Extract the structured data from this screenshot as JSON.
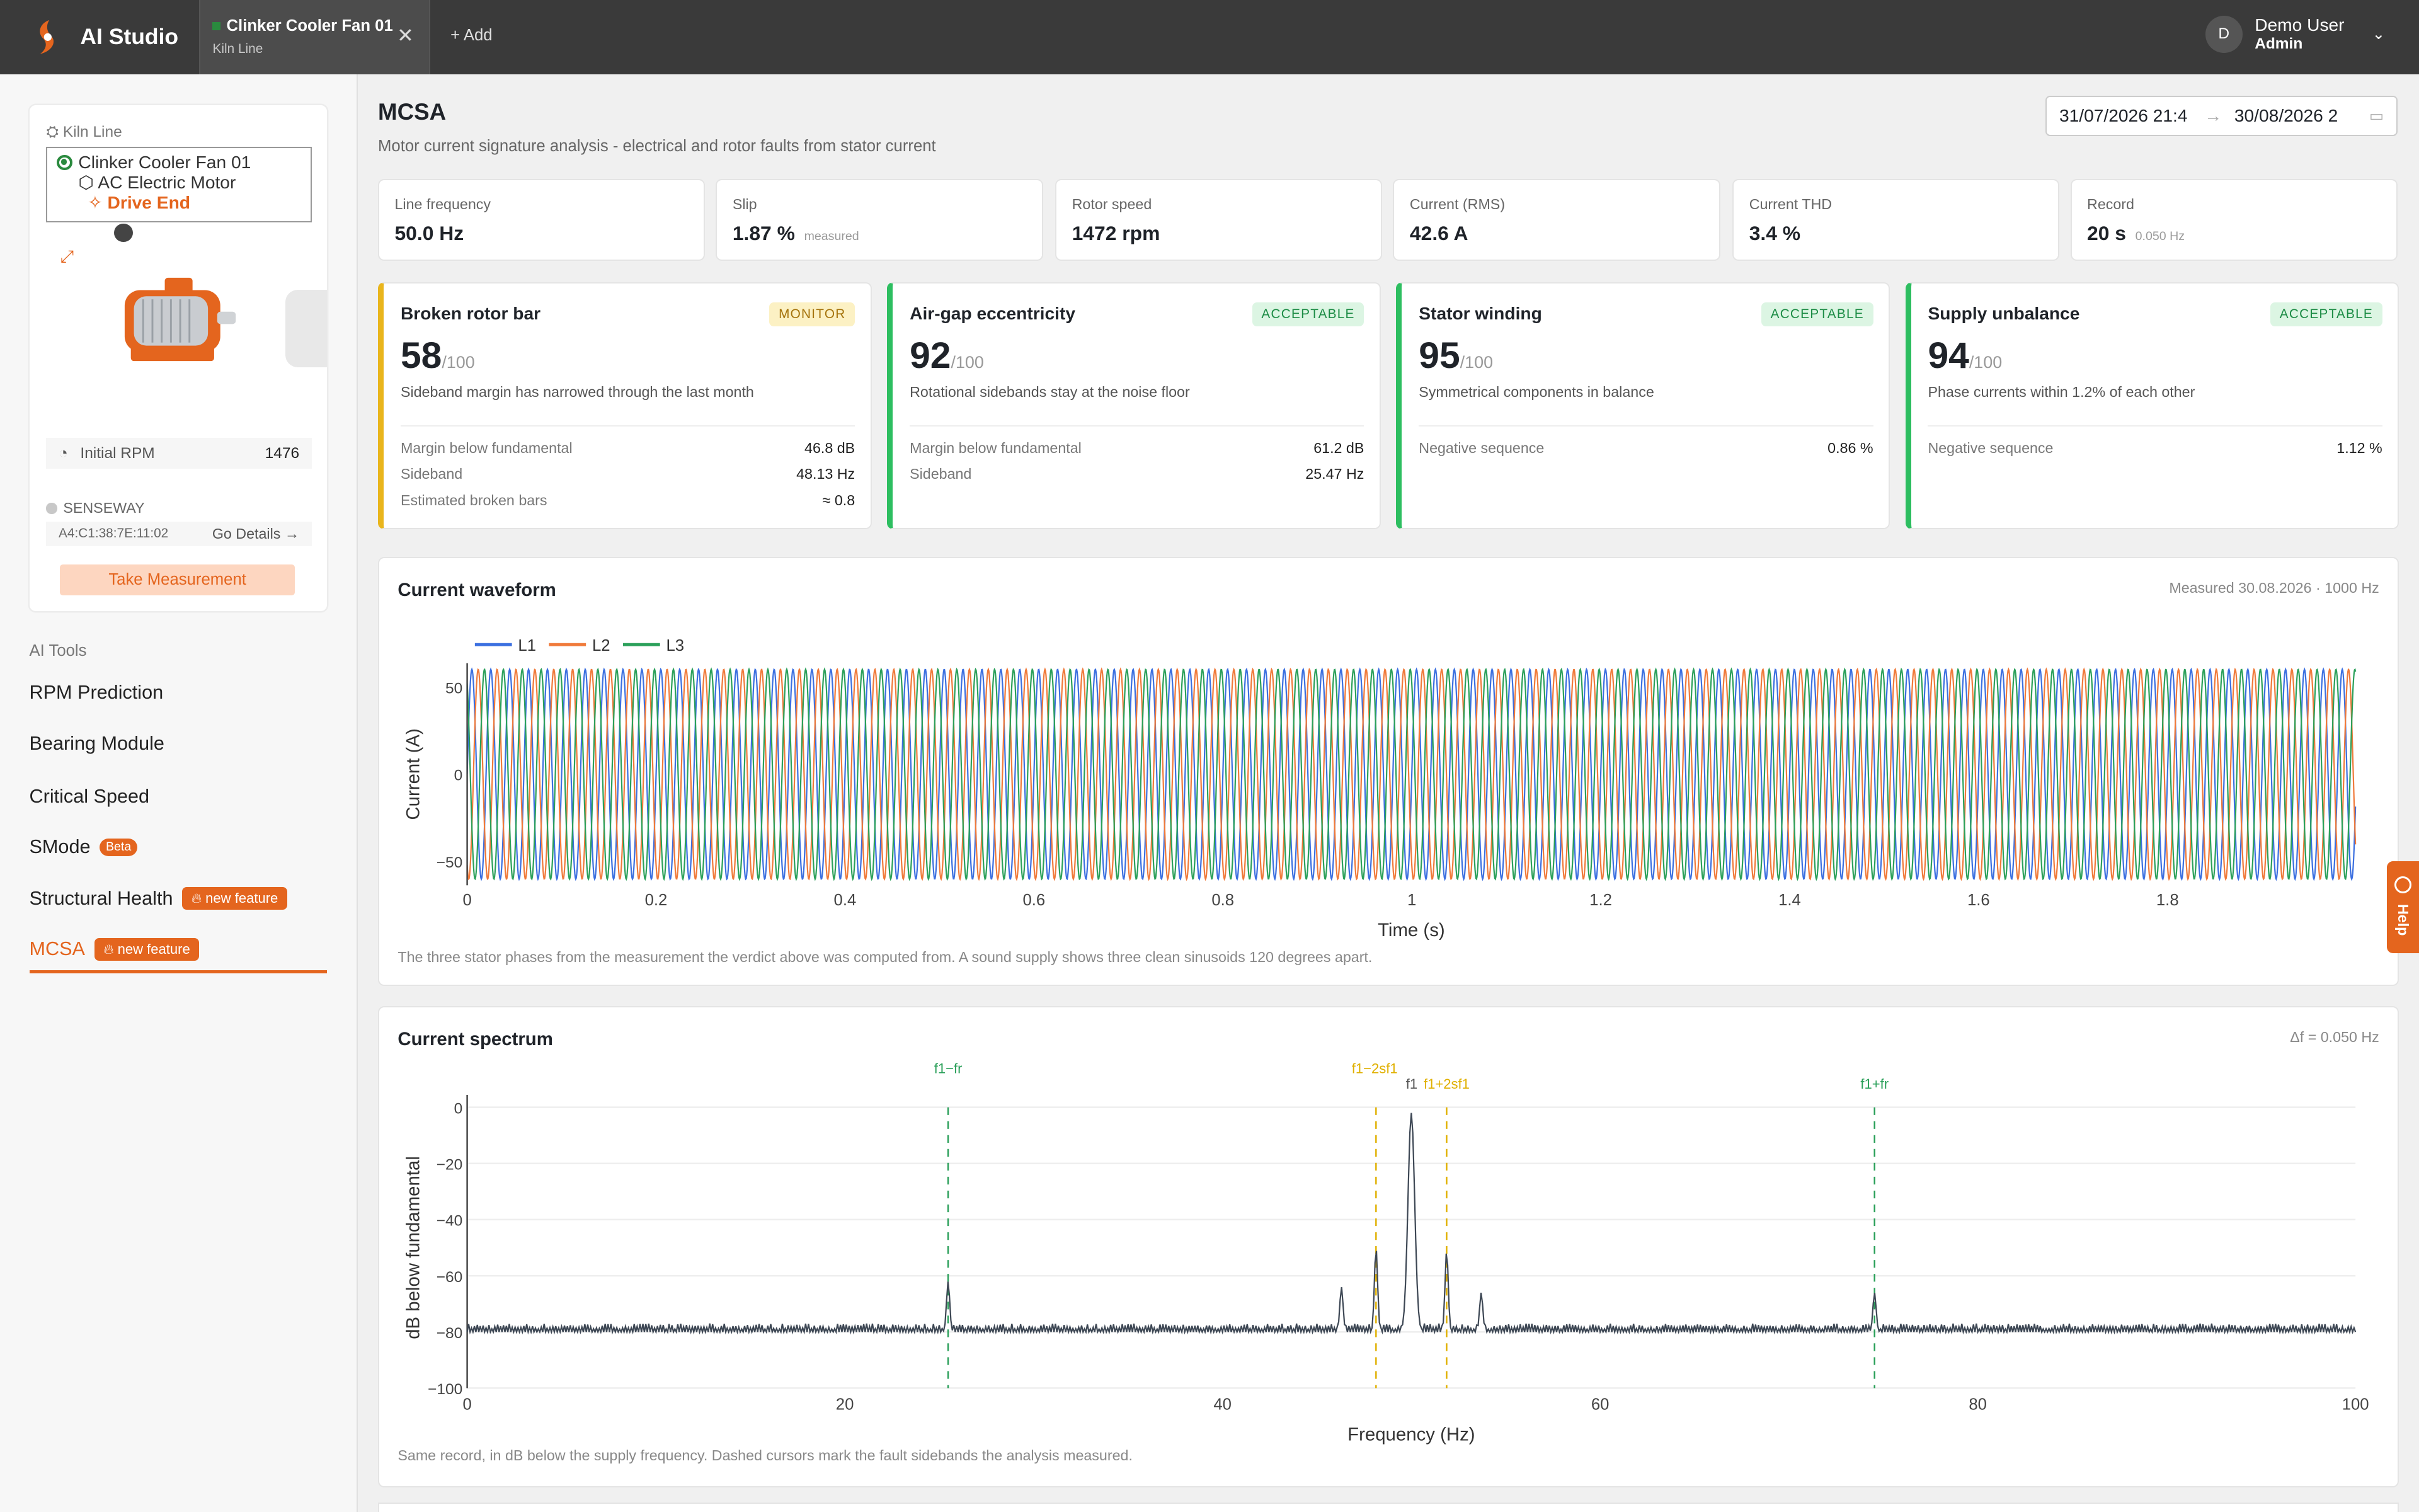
{
  "app": {
    "name": "AI Studio"
  },
  "tab": {
    "title": "Clinker Cooler Fan 01",
    "subtitle": "Kiln Line",
    "add_label": "Add"
  },
  "user": {
    "initial": "D",
    "name": "Demo User",
    "role": "Admin"
  },
  "asset": {
    "breadcrumb": "Kiln Line",
    "tree": [
      "Clinker Cooler Fan 01",
      "AC Electric Motor",
      "Drive End"
    ],
    "initial_rpm_label": "Initial RPM",
    "initial_rpm_value": "1476",
    "sensor_name": "SENSEWAY",
    "sensor_mac": "A4:C1:38:7E:11:02",
    "go_details": "Go Details",
    "measure_button": "Take Measurement"
  },
  "tools": {
    "title": "AI Tools",
    "items": [
      {
        "label": "RPM Prediction"
      },
      {
        "label": "Bearing Module"
      },
      {
        "label": "Critical Speed"
      },
      {
        "label": "SMode",
        "badge": "Beta"
      },
      {
        "label": "Structural Health",
        "badge": "new feature"
      },
      {
        "label": "MCSA",
        "badge": "new feature",
        "active": true
      }
    ]
  },
  "page": {
    "title": "MCSA",
    "subtitle": "Motor current signature analysis - electrical and rotor faults from stator current",
    "date_from": "31/07/2026 21:4",
    "date_to": "30/08/2026 2"
  },
  "kpis": [
    {
      "label": "Line frequency",
      "value": "50.0 Hz",
      "note": ""
    },
    {
      "label": "Slip",
      "value": "1.87 %",
      "note": "measured"
    },
    {
      "label": "Rotor speed",
      "value": "1472 rpm",
      "note": ""
    },
    {
      "label": "Current (RMS)",
      "value": "42.6 A",
      "note": ""
    },
    {
      "label": "Current THD",
      "value": "3.4 %",
      "note": ""
    },
    {
      "label": "Record",
      "value": "20 s",
      "note": "0.050 Hz"
    }
  ],
  "faults": [
    {
      "title": "Broken rotor bar",
      "status": "MONITOR",
      "score": "58",
      "out_of": "/100",
      "desc": "Sideband margin has narrowed through the last month",
      "rows": [
        {
          "k": "Margin below fundamental",
          "v": "46.8 dB"
        },
        {
          "k": "Sideband",
          "v": "48.13 Hz"
        },
        {
          "k": "Estimated broken bars",
          "v": "≈ 0.8"
        }
      ]
    },
    {
      "title": "Air-gap eccentricity",
      "status": "ACCEPTABLE",
      "score": "92",
      "out_of": "/100",
      "desc": "Rotational sidebands stay at the noise floor",
      "rows": [
        {
          "k": "Margin below fundamental",
          "v": "61.2 dB"
        },
        {
          "k": "Sideband",
          "v": "25.47 Hz"
        }
      ]
    },
    {
      "title": "Stator winding",
      "status": "ACCEPTABLE",
      "score": "95",
      "out_of": "/100",
      "desc": "Symmetrical components in balance",
      "rows": [
        {
          "k": "Negative sequence",
          "v": "0.86 %"
        }
      ]
    },
    {
      "title": "Supply unbalance",
      "status": "ACCEPTABLE",
      "score": "94",
      "out_of": "/100",
      "desc": "Phase currents within 1.2% of each other",
      "rows": [
        {
          "k": "Negative sequence",
          "v": "1.12 %"
        }
      ]
    }
  ],
  "waveform": {
    "title": "Current waveform",
    "meta": "Measured 30.08.2026 · 1000 Hz",
    "caption": "The three stator phases from the measurement the verdict above was computed from. A sound supply shows three clean sinusoids 120 degrees apart."
  },
  "spectrum": {
    "title": "Current spectrum",
    "meta": "Δf = 0.050 Hz",
    "caption": "Same record, in dB below the supply frequency. Dashed cursors mark the fault sidebands the analysis measured."
  },
  "help_label": "Help",
  "chart_data": [
    {
      "type": "line",
      "xlabel": "Time (s)",
      "ylabel": "Current (A)",
      "xlim": [
        0,
        1.999
      ],
      "ylim": [
        -62,
        62
      ],
      "xticks": [
        0,
        0.2,
        0.4,
        0.6,
        0.8,
        1,
        1.2,
        1.4,
        1.6,
        1.8
      ],
      "xtick_labels": [
        "0",
        "0.2",
        "0.4",
        "0.6",
        "0.8",
        "1",
        "1.2",
        "1.4",
        "1.6",
        "1.8"
      ],
      "yticks": [
        50,
        0,
        -50
      ],
      "ytick_labels": [
        "50",
        "0",
        "−50"
      ],
      "legend": "top-left",
      "frequency_hz": 50,
      "amplitude": 60.2,
      "series": [
        {
          "name": "L1",
          "phase_deg": 0,
          "color": "#3b6fe0"
        },
        {
          "name": "L2",
          "phase_deg": -120,
          "color": "#f07a3a"
        },
        {
          "name": "L3",
          "phase_deg": 120,
          "color": "#2ba05a"
        }
      ]
    },
    {
      "type": "line",
      "xlabel": "Frequency (Hz)",
      "ylabel": "dB below fundamental",
      "xlim": [
        0,
        100
      ],
      "ylim": [
        -100,
        0
      ],
      "xticks": [
        0,
        20,
        40,
        60,
        80,
        100
      ],
      "xtick_labels": [
        "0",
        "20",
        "40",
        "60",
        "80",
        "100"
      ],
      "yticks": [
        0,
        -20,
        -40,
        -60,
        -80,
        -100
      ],
      "ytick_labels": [
        "0",
        "−20",
        "−40",
        "−60",
        "−80",
        "−100"
      ],
      "noise_floor": -80,
      "peaks": [
        {
          "x": 25.47,
          "y": -62
        },
        {
          "x": 46.3,
          "y": -64
        },
        {
          "x": 48.13,
          "y": -50
        },
        {
          "x": 50.0,
          "y": -2
        },
        {
          "x": 51.87,
          "y": -51
        },
        {
          "x": 53.7,
          "y": -66
        },
        {
          "x": 74.53,
          "y": -66
        }
      ],
      "cursors": [
        {
          "label": "f1−fr",
          "x": 25.47,
          "color": "#2ba05a"
        },
        {
          "label": "f1−2sf1",
          "x": 48.13,
          "color": "#e0b000"
        },
        {
          "label": "f1",
          "x": 50.0,
          "color": "#555555"
        },
        {
          "label": "f1+2sf1",
          "x": 51.87,
          "color": "#e0b000"
        },
        {
          "label": "f1+fr",
          "x": 74.53,
          "color": "#2ba05a"
        }
      ]
    }
  ]
}
